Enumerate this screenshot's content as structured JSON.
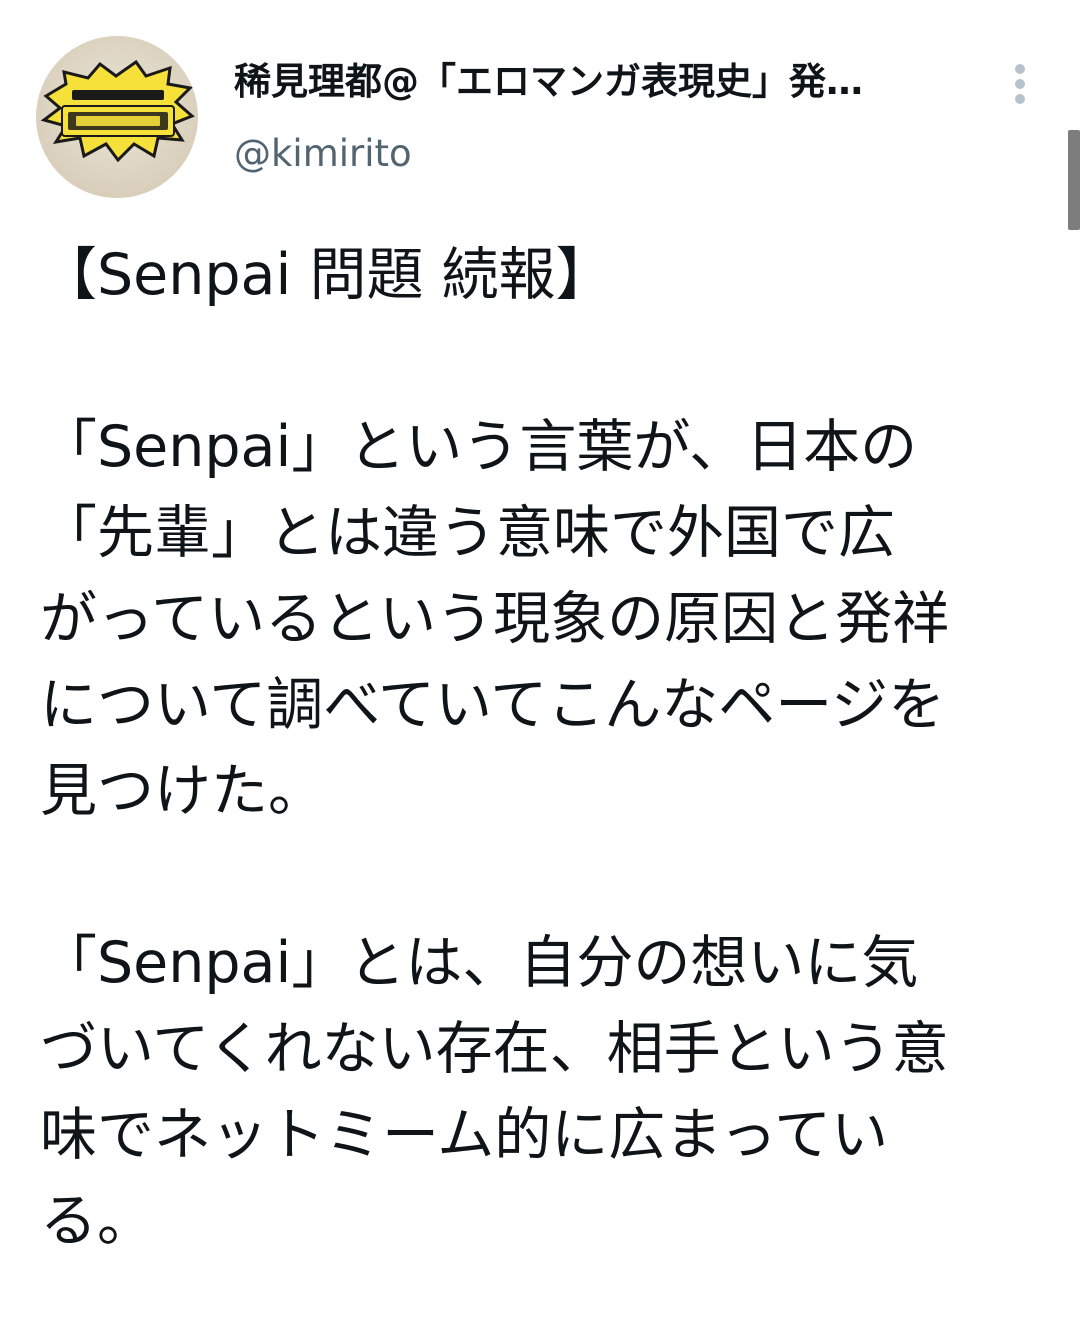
{
  "author": {
    "display_name": "稀見理都@「エロマンガ表現史」発…",
    "handle": "@kimirito",
    "avatar_icon": "avatar-image"
  },
  "tweet": {
    "heading": "【Senpai 問題 続報】",
    "paragraph1": [
      "「Senpai」という言葉が、日本の",
      "「先輩」とは違う意味で外国で広",
      "がっているという現象の原因と発祥",
      "について調べていてこんなページを",
      "見つけた。"
    ],
    "paragraph2": [
      "「Senpai」とは、自分の想いに気",
      "づいてくれない存在、相手という意",
      "味でネットミーム的に広まってい",
      "る。"
    ]
  },
  "icons": {
    "more": "more-vertical-icon"
  },
  "colors": {
    "text": "#0f1419",
    "secondary": "#536471",
    "more_dots": "#b8c2cc"
  }
}
